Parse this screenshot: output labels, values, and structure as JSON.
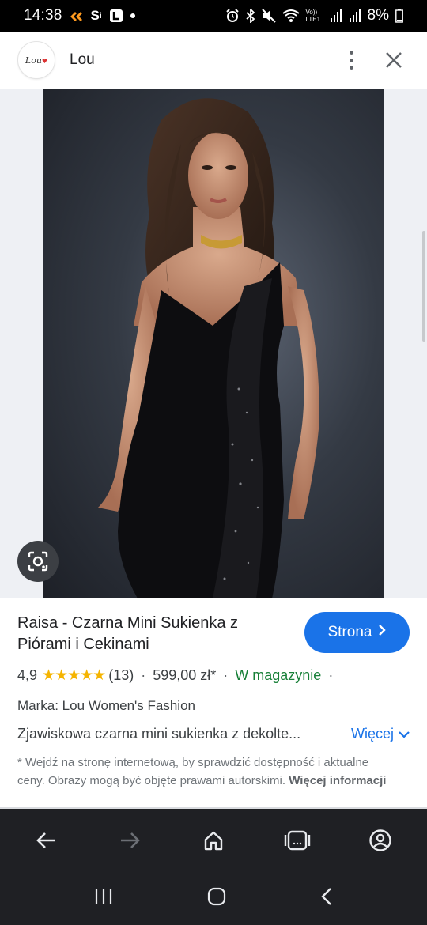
{
  "status_bar": {
    "time": "14:38",
    "battery": "8%",
    "network_label": "Vo)) LTE1",
    "icons": [
      "notification-app-icon",
      "s-app-icon",
      "l-app-icon",
      "dot-icon",
      "alarm-icon",
      "bluetooth-icon",
      "mute-icon",
      "wifi-icon",
      "signal-icon",
      "signal-icon",
      "battery-icon"
    ]
  },
  "header": {
    "logo_text": "Lou",
    "site_name": "Lou",
    "menu_icon": "more-vert-icon",
    "close_icon": "close-icon"
  },
  "image": {
    "lens_icon": "lens-search-icon"
  },
  "product": {
    "title": "Raisa - Czarna Mini Sukienka z Piórami i Cekinami",
    "visit_button": "Strona",
    "rating": "4,9",
    "stars": "★★★★★",
    "reviews": "(13)",
    "price": "599,00 zł*",
    "availability": "W magazynie",
    "brand": "Marka: Lou Women's Fashion",
    "description": "Zjawiskowa czarna mini sukienka z dekolte...",
    "more_label": "Więcej",
    "disclaimer": "* Wejdź na stronę internetową, by sprawdzić dostępność i aktualne ceny. Obrazy mogą być objęte prawami autorskimi.",
    "more_info": "Więcej informacji"
  },
  "browser_bar": {
    "icons": [
      "back-arrow-icon",
      "forward-arrow-icon",
      "home-icon",
      "tabs-icon",
      "account-icon"
    ]
  },
  "system_nav": {
    "icons": [
      "recents-icon",
      "home-circle-icon",
      "back-chevron-icon"
    ]
  },
  "colors": {
    "accent": "#1a73e8",
    "stars": "#f5b400",
    "in_stock": "#188038",
    "bottom_bar": "#1f2024"
  }
}
